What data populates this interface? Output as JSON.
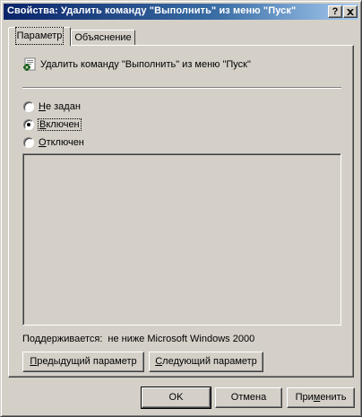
{
  "window": {
    "title": "Свойства: Удалить команду \"Выполнить\" из меню \"Пуск\"",
    "help_button": "?",
    "close_button": "X"
  },
  "tabs": [
    {
      "label": "Параметр",
      "active": true
    },
    {
      "label": "Объяснение",
      "active": false
    }
  ],
  "policy": {
    "icon": "policy-setting-icon",
    "title": "Удалить команду \"Выполнить\" из меню \"Пуск\""
  },
  "options": [
    {
      "accel": "Н",
      "rest": "е задан",
      "checked": false
    },
    {
      "accel": "В",
      "rest": "ключен",
      "checked": true
    },
    {
      "accel": "О",
      "rest": "тключен",
      "checked": false
    }
  ],
  "supported": {
    "label": "Поддерживается:",
    "value": "не ниже Microsoft Windows 2000"
  },
  "nav_buttons": {
    "prev_accel": "П",
    "prev_rest": "редыдущий параметр",
    "next_accel": "С",
    "next_rest": "ледующий параметр"
  },
  "dialog_buttons": {
    "ok": "OK",
    "cancel": "Отмена",
    "apply_pre": "При",
    "apply_accel": "м",
    "apply_post": "енить"
  }
}
